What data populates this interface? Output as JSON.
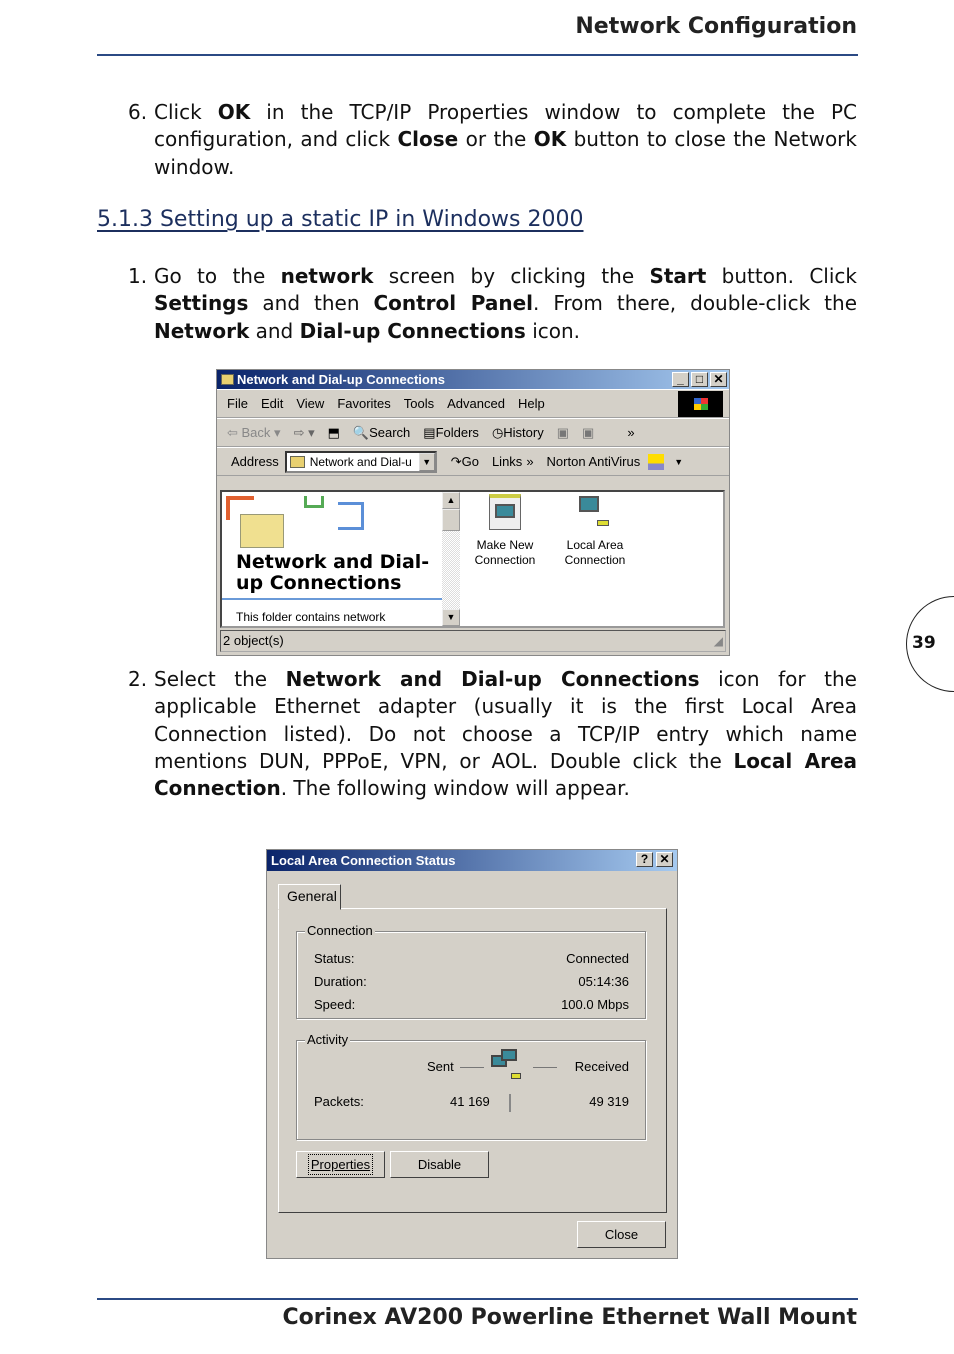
{
  "header": {
    "title": "Network Configuration"
  },
  "step6": {
    "num": "6.",
    "s": [
      "Click ",
      "OK",
      " in the TCP/IP Properties window to complete the PC configuration, and click ",
      "Close",
      " or the ",
      "OK",
      " button to close the Network window."
    ]
  },
  "section": {
    "heading": "5.1.3 Setting up a static IP in Windows 2000"
  },
  "step1": {
    "num": "1.",
    "s": [
      "Go to the ",
      "network",
      " screen by clicking the ",
      "Start",
      " button. Click ",
      "Settings",
      " and then ",
      "Control Panel",
      ". From there, double-click the ",
      "Network",
      " and ",
      "Dial-up Connections",
      " icon."
    ]
  },
  "window1": {
    "title": "Network and Dial-up Connections",
    "menu": [
      "File",
      "Edit",
      "View",
      "Favorites",
      "Tools",
      "Advanced",
      "Help"
    ],
    "toolbar": [
      "Back",
      "Search",
      "Folders",
      "History"
    ],
    "address_label": "Address",
    "address_value": "Network and Dial-u",
    "go": "Go",
    "links": "Links",
    "norton": "Norton AntiVirus",
    "panel_title": "Network and Dial-up Connections",
    "panel_text": "This folder contains network",
    "icons": [
      {
        "label1": "Make New",
        "label2": "Connection"
      },
      {
        "label1": "Local Area",
        "label2": "Connection"
      }
    ],
    "status": "2 object(s)"
  },
  "step2": {
    "num": "2.",
    "s": [
      "Select the ",
      "Network and Dial-up Connections",
      " icon for the applicable Ethernet adapter (usually it is the first Local Area Connection listed). Do not choose a TCP/IP entry which name mentions DUN, PPPoE, VPN, or AOL. Double click the ",
      "Local Area Connection",
      ". The following window will appear."
    ]
  },
  "window2": {
    "title": "Local Area Connection Status",
    "tab": "General",
    "connection": {
      "legend": "Connection",
      "rows": [
        {
          "k": "Status:",
          "v": "Connected"
        },
        {
          "k": "Duration:",
          "v": "05:14:36"
        },
        {
          "k": "Speed:",
          "v": "100.0 Mbps"
        }
      ]
    },
    "activity": {
      "legend": "Activity",
      "sent": "Sent",
      "received": "Received",
      "packets_label": "Packets:",
      "sent_value": "41 169",
      "received_value": "49 319"
    },
    "buttons": {
      "properties": "Properties",
      "disable": "Disable",
      "close": "Close"
    }
  },
  "page_number": "39",
  "footer": {
    "title": "Corinex AV200 Powerline Ethernet Wall Mount"
  },
  "colors": {
    "rule": "#2b4a84",
    "titlebar": "#0a246a",
    "window": "#d4d0c8"
  }
}
